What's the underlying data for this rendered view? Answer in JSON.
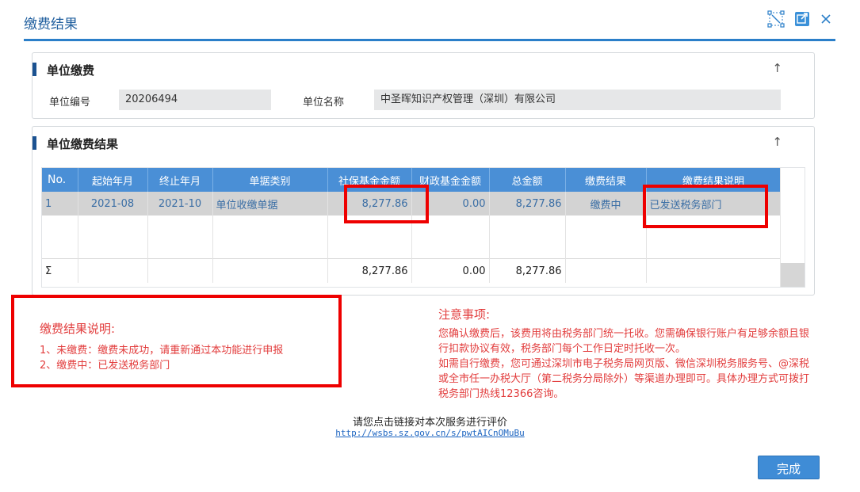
{
  "window": {
    "title": "缴费结果",
    "icons": [
      "fullscreen-icon",
      "popout-icon",
      "close-icon"
    ]
  },
  "unit_panel": {
    "title": "单位缴费",
    "unit_no_label": "单位编号",
    "unit_no_value": "20206494",
    "unit_name_label": "单位名称",
    "unit_name_value": "中圣晖知识产权管理（深圳）有限公司",
    "collapse_arrow": "↑"
  },
  "result_panel": {
    "title": "单位缴费结果",
    "collapse_arrow": "↑",
    "table": {
      "columns": [
        "No.",
        "起始年月",
        "终止年月",
        "单据类别",
        "社保基金金额",
        "财政基金金额",
        "总金额",
        "缴费结果",
        "缴费结果说明"
      ],
      "rows": [
        [
          "1",
          "2021-08",
          "2021-10",
          "单位收缴单据",
          "8,277.86",
          "0.00",
          "8,277.86",
          "缴费中",
          "已发送税务部门"
        ]
      ],
      "sum": [
        "Σ",
        "",
        "",
        "",
        "8,277.86",
        "0.00",
        "8,277.86",
        "",
        ""
      ]
    }
  },
  "explain": {
    "heading": "缴费结果说明:",
    "lines": [
      "1、未缴费：缴费未成功，请重新通过本功能进行申报",
      "2、缴费中：已发送税务部门"
    ]
  },
  "notice": {
    "heading": "注意事项:",
    "paragraphs": [
      "您确认缴费后，该费用将由税务部门统一托收。您需确保银行账户有足够余额且银行扣款协议有效，税务部门每个工作日定时托收一次。",
      "如需自行缴费，您可通过深圳市电子税务局网页版、微信深圳税务服务号、@深税或全市任一办税大厅（第二税务分局除外）等渠道办理即可。具体办理方式可拨打税务部门热线12366咨询。"
    ]
  },
  "evaluation": {
    "text": "请您点击链接对本次服务进行评价",
    "link": "http://wsbs.sz.gov.cn/s/pwtAICnOMuBu"
  },
  "footer": {
    "done_label": "完成"
  },
  "colors": {
    "accent": "#2b7fc9",
    "header_blue": "#4a8fd6",
    "warning_red": "#e23d3d",
    "highlight_box": "#ee0000"
  }
}
